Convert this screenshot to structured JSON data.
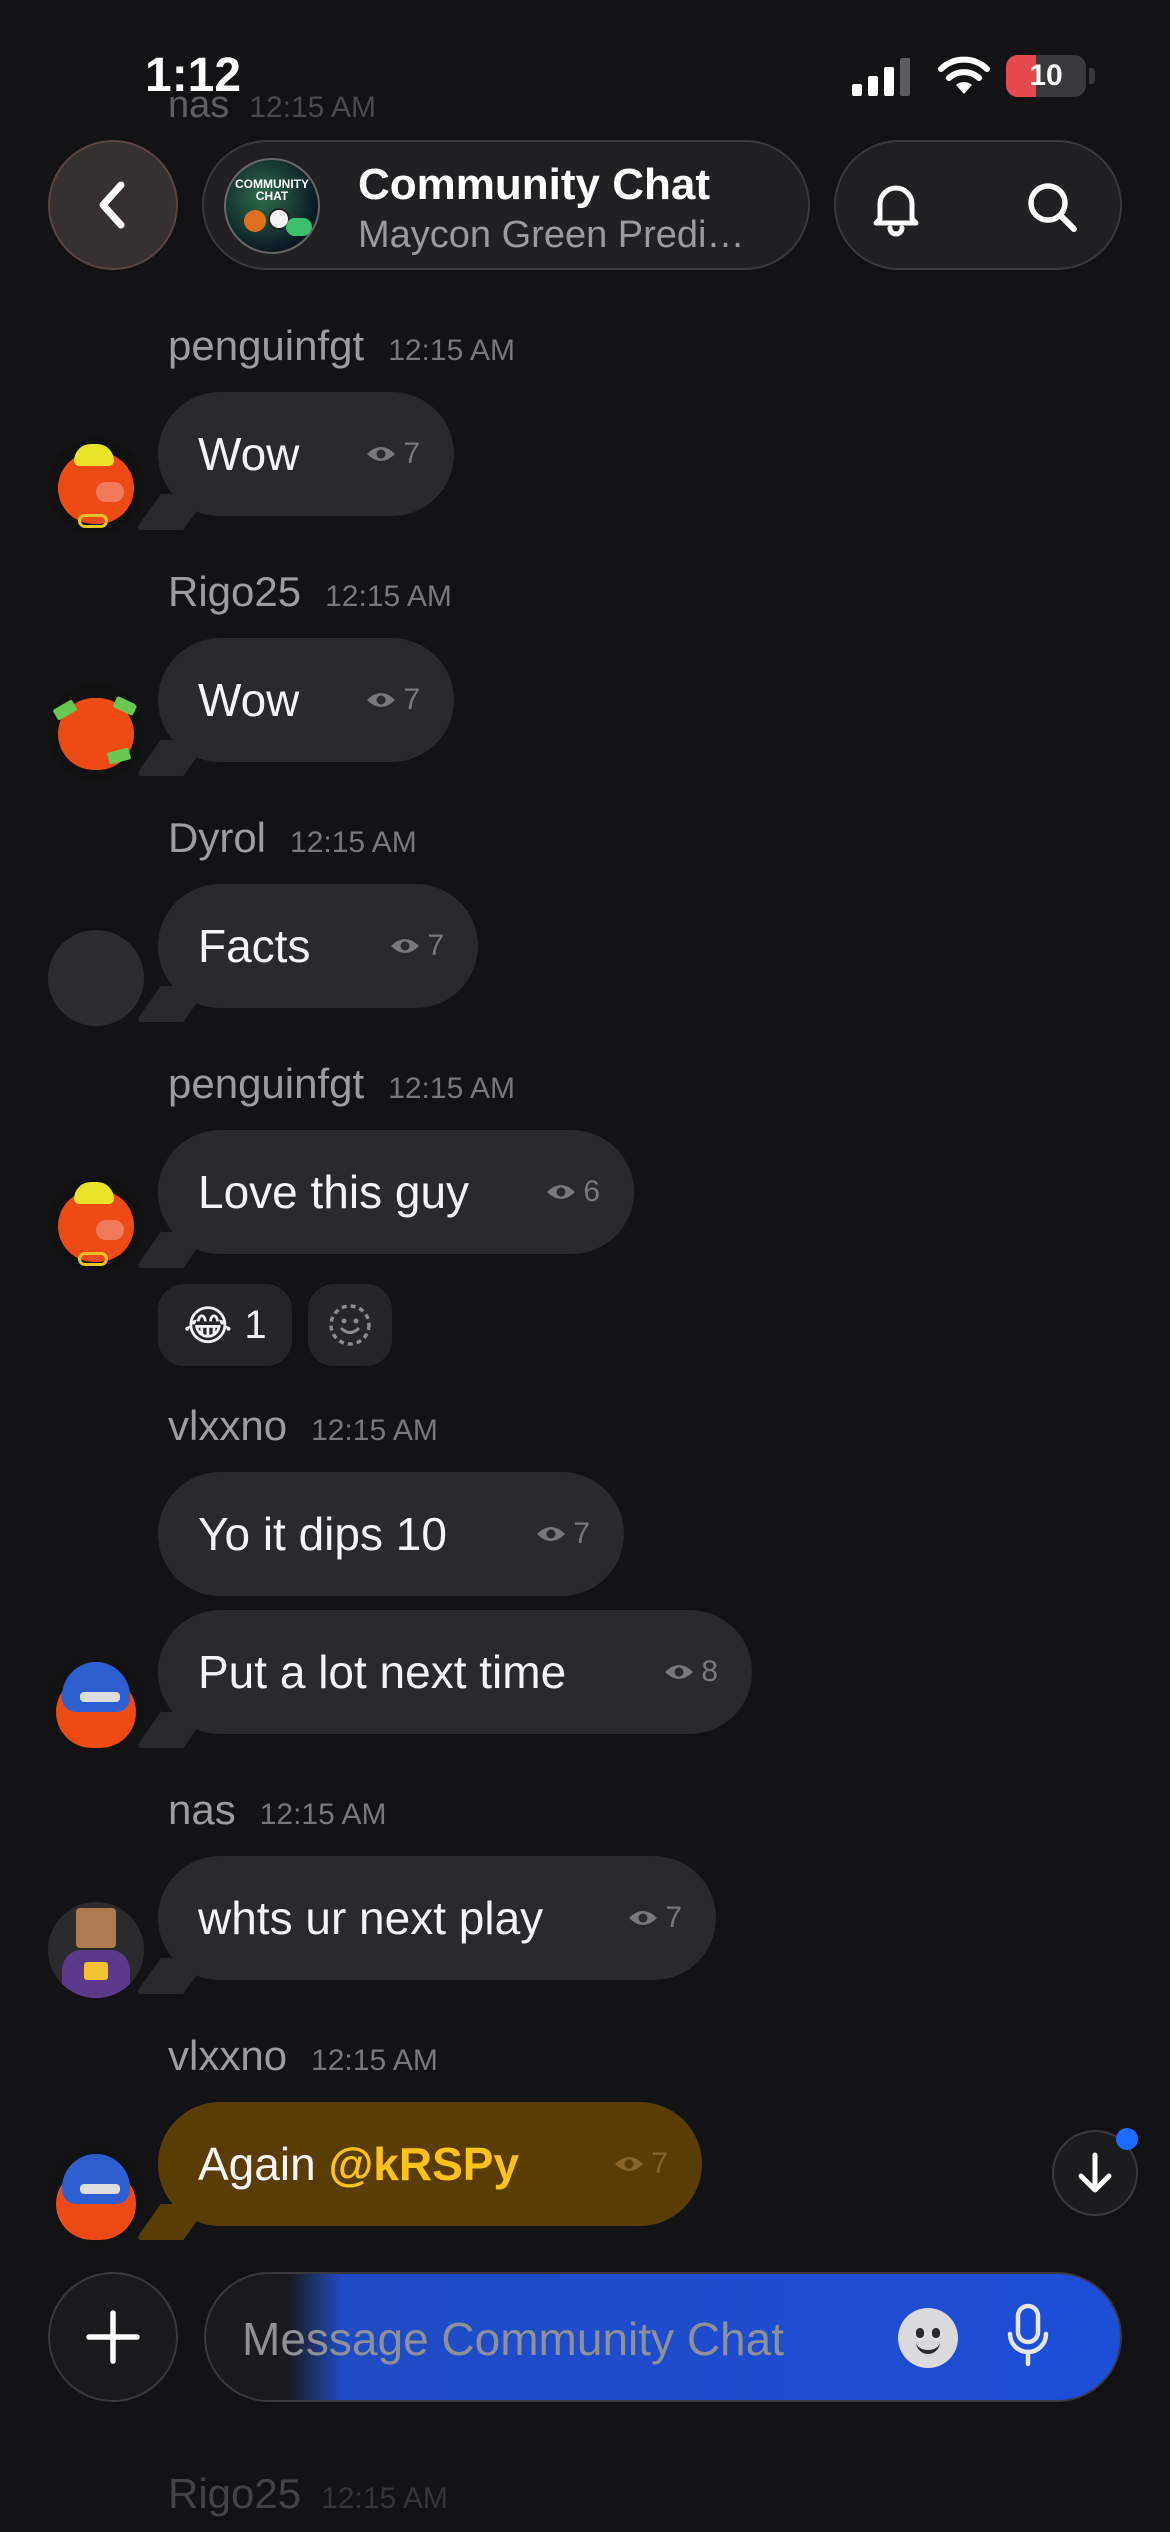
{
  "status_bar": {
    "time": "1:12",
    "battery": "10"
  },
  "header": {
    "title": "Community Chat",
    "subtitle": "Maycon Green Predi…",
    "avatar_label": "COMMUNITY CHAT"
  },
  "top_ghost": {
    "name": "nas",
    "time": "12:15 AM"
  },
  "messages": [
    {
      "name": "penguinfgt",
      "time": "12:15 AM",
      "text": "Wow",
      "views": "7"
    },
    {
      "name": "Rigo25",
      "time": "12:15 AM",
      "text": "Wow",
      "views": "7"
    },
    {
      "name": "Dyrol",
      "time": "12:15 AM",
      "text": "Facts",
      "views": "7"
    },
    {
      "name": "penguinfgt",
      "time": "12:15 AM",
      "text": "Love this guy",
      "views": "6"
    },
    {
      "name": "vlxxno",
      "time": "12:15 AM",
      "text": "Yo it dips 10",
      "views": "7"
    },
    {
      "text": "Put a lot next time",
      "views": "8"
    },
    {
      "name": "nas",
      "time": "12:15 AM",
      "text": "whts ur next play",
      "views": "7"
    },
    {
      "name": "vlxxno",
      "time": "12:15 AM",
      "text": "Again ",
      "mention": "@kRSPy",
      "views": "7"
    }
  ],
  "reactions": [
    {
      "emoji": "😂",
      "count": "1"
    }
  ],
  "composer": {
    "placeholder": "Message Community Chat"
  },
  "bottom_ghost": {
    "name": "Rigo25",
    "time": "12:15 AM"
  },
  "colors": {
    "background": "#131214",
    "bubble": "#2a292c",
    "mention": "#ffc21a",
    "accent_blue": "#1e6bff"
  }
}
